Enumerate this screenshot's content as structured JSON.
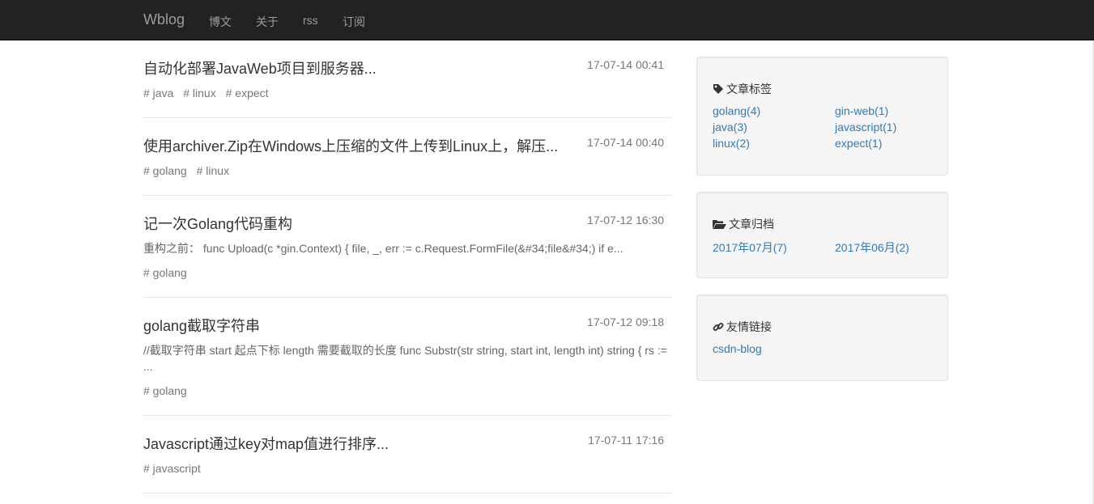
{
  "nav": {
    "brand": "Wblog",
    "links": [
      "博文",
      "关于",
      "rss",
      "订阅"
    ]
  },
  "posts": [
    {
      "title": "自动化部署JavaWeb项目到服务器...",
      "date": "17-07-14 00:41",
      "excerpt": "",
      "tags": [
        "# java",
        "# linux",
        "# expect"
      ]
    },
    {
      "title": "使用archiver.Zip在Windows上压缩的文件上传到Linux上，解压...",
      "date": "17-07-14 00:40",
      "excerpt": "",
      "tags": [
        "# golang",
        "# linux"
      ]
    },
    {
      "title": "记一次Golang代码重构",
      "date": "17-07-12 16:30",
      "excerpt": "重构之前： func Upload(c *gin.Context) { file, _, err := c.Request.FormFile(&#34;file&#34;) if e...",
      "tags": [
        "# golang"
      ]
    },
    {
      "title": "golang截取字符串",
      "date": "17-07-12 09:18",
      "excerpt": "//截取字符串 start 起点下标 length 需要截取的长度 func Substr(str string, start int, length int) string { rs := ...",
      "tags": [
        "# golang"
      ]
    },
    {
      "title": "Javascript通过key对map值进行排序...",
      "date": "17-07-11 17:16",
      "excerpt": "",
      "tags": [
        "# javascript"
      ]
    }
  ],
  "sidebar": {
    "tags_panel": {
      "heading": "文章标签",
      "icon": "tag-icon",
      "items": [
        "golang(4)",
        "gin-web(1)",
        "java(3)",
        "javascript(1)",
        "linux(2)",
        "expect(1)"
      ]
    },
    "archive_panel": {
      "heading": "文章归档",
      "icon": "folder-open-icon",
      "items": [
        "2017年07月(7)",
        "2017年06月(2)"
      ]
    },
    "links_panel": {
      "heading": "友情链接",
      "icon": "link-icon",
      "items": [
        "csdn-blog"
      ]
    }
  },
  "colors": {
    "navbar_bg": "#222222",
    "nav_text": "#9d9d9d",
    "link": "#337ab7",
    "panel_bg": "#f5f5f5"
  }
}
